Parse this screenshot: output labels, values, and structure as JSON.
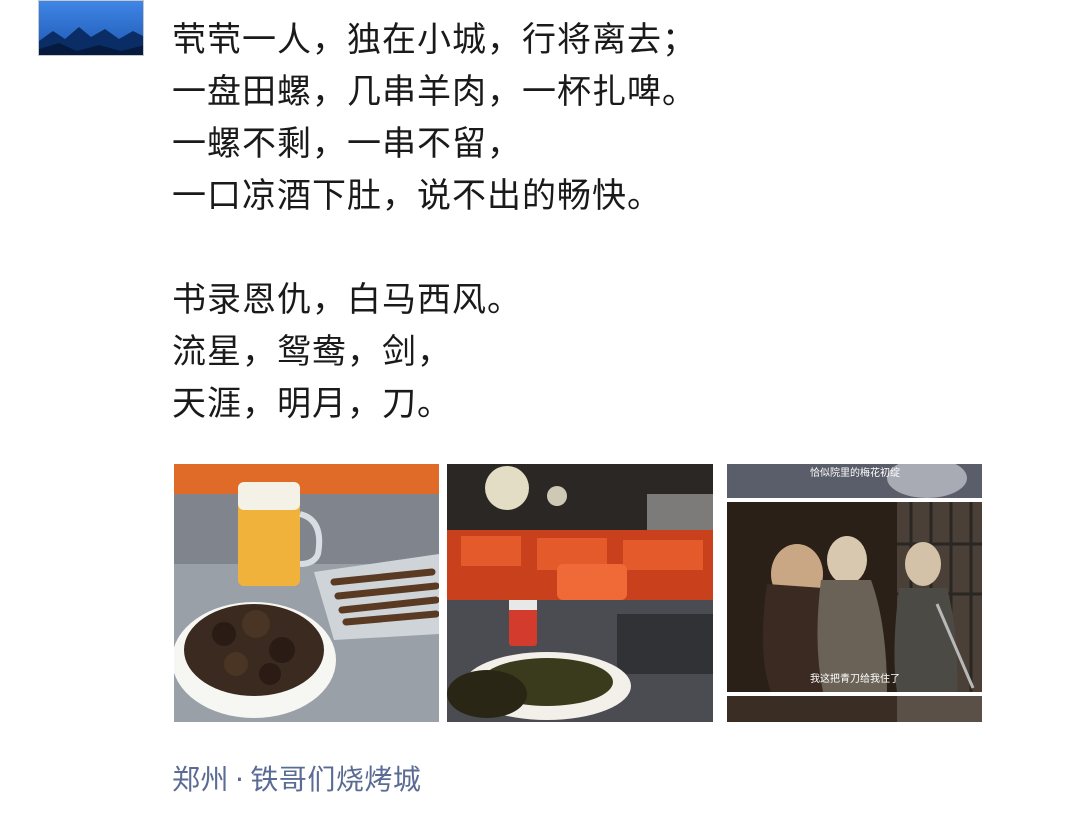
{
  "post": {
    "lines": [
      "茕茕一人，独在小城，行将离去；",
      "一盘田螺，几串羊肉，一杯扎啤。",
      "一螺不剩，一串不留，",
      "一口凉酒下肚，说不出的畅快。",
      "",
      "书录恩仇，白马西风。",
      "流星，鸳鸯，剑，",
      "天涯，明月，刀。"
    ],
    "photos": [
      {
        "icon": "beer-skewers-photo"
      },
      {
        "icon": "restaurant-tables-photo"
      },
      {
        "icon": "movie-still-photo",
        "subtitle_top": "恰似院里的梅花初绽",
        "subtitle_bottom": "我这把青刀给我住了"
      }
    ],
    "location": {
      "city": "郑州",
      "separator": "·",
      "place": "铁哥们烧烤城"
    }
  },
  "colors": {
    "location_link": "#5a6b94",
    "text": "#1a1a1a"
  }
}
